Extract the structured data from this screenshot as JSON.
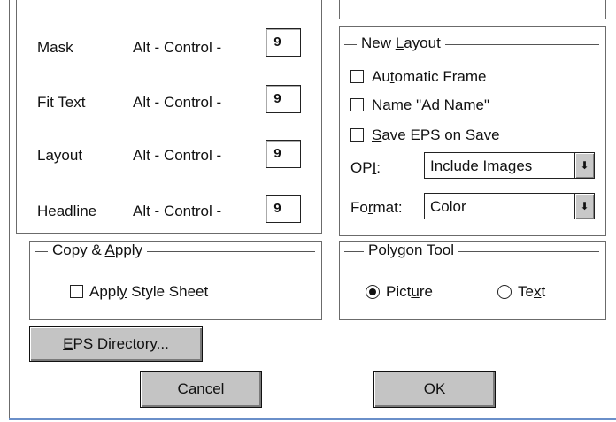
{
  "shortcuts": [
    {
      "label": "Mask",
      "modifier": "Alt - Control -",
      "key": "9"
    },
    {
      "label": "Fit Text",
      "modifier": "Alt - Control -",
      "key": "9"
    },
    {
      "label": "Layout",
      "modifier": "Alt - Control -",
      "key": "9"
    },
    {
      "label": "Headline",
      "modifier": "Alt - Control -",
      "key": "9"
    }
  ],
  "new_layout": {
    "title_pre": "New ",
    "title_ul": "L",
    "title_post": "ayout",
    "automatic_frame": {
      "pre": "Au",
      "ul": "t",
      "post": "omatic Frame",
      "checked": false
    },
    "name_ad": {
      "pre": "Na",
      "ul": "m",
      "post": "e \"Ad Name\"",
      "checked": false
    },
    "save_eps": {
      "pre": "",
      "ul": "S",
      "post": "ave EPS on Save",
      "checked": false
    },
    "opi": {
      "pre": "OP",
      "ul": "I",
      "post": ":",
      "value": "Include Images"
    },
    "format": {
      "pre": "Fo",
      "ul": "r",
      "post": "mat:",
      "value": "Color"
    }
  },
  "copy_apply": {
    "title_pre": "Copy & ",
    "title_ul": "A",
    "title_post": "pply",
    "apply_style": {
      "pre": "Appl",
      "ul": "y",
      "post": " Style Sheet",
      "checked": false
    }
  },
  "polygon_tool": {
    "title": "Polygon Tool",
    "picture": {
      "pre": "Pict",
      "ul": "u",
      "post": "re",
      "selected": true
    },
    "text": {
      "pre": "Te",
      "ul": "x",
      "post": "t",
      "selected": false
    }
  },
  "buttons": {
    "eps_dir": {
      "pre": "",
      "ul": "E",
      "post": "PS Directory..."
    },
    "cancel": {
      "pre": "",
      "ul": "C",
      "post": "ancel"
    },
    "ok": {
      "pre": "",
      "ul": "O",
      "post": "K"
    }
  },
  "colors": {
    "button_face": "#c4c4c4",
    "window_bg": "#ffffff",
    "border": "#6b6b6b"
  }
}
